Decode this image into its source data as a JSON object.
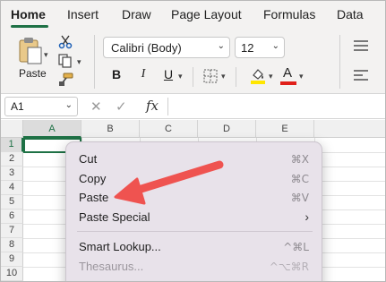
{
  "ribbon_tabs": [
    "Home",
    "Insert",
    "Draw",
    "Page Layout",
    "Formulas",
    "Data"
  ],
  "clipboard": {
    "paste_label": "Paste"
  },
  "font": {
    "name": "Calibri (Body)",
    "size": "12"
  },
  "format_buttons": {
    "bold": "B",
    "italic": "I",
    "underline": "U",
    "font_color_letter": "A"
  },
  "colors": {
    "accent": "#1e7145",
    "highlight": "#ffe600",
    "font_color": "#e0201a",
    "arrow": "#ef5350"
  },
  "formula_bar": {
    "name_box": "A1",
    "fx_label": "fx",
    "cancel_icon": "✕",
    "enter_icon": "✓"
  },
  "columns": [
    "A",
    "B",
    "C",
    "D",
    "E"
  ],
  "rows": [
    "1",
    "2",
    "3",
    "4",
    "5",
    "6",
    "7",
    "8",
    "9",
    "10"
  ],
  "context_menu": {
    "items": [
      {
        "label": "Cut",
        "shortcut": "⌘X"
      },
      {
        "label": "Copy",
        "shortcut": "⌘C"
      },
      {
        "label": "Paste",
        "shortcut": "⌘V"
      },
      {
        "label": "Paste Special",
        "shortcut": ""
      },
      {
        "label": "Smart Lookup...",
        "shortcut": "^⌘L"
      },
      {
        "label": "Thesaurus...",
        "shortcut": "^⌥⌘R"
      }
    ]
  }
}
